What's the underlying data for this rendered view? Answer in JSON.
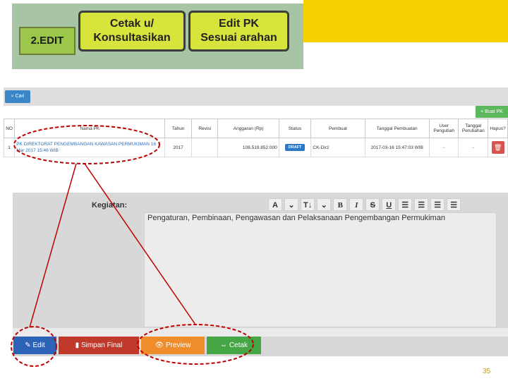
{
  "banner": {
    "edit_tab": "2.EDIT",
    "pill_cetak": [
      "Cetak u/",
      "Konsultasikan"
    ],
    "pill_edit": [
      "Edit PK",
      "Sesuai  arahan"
    ]
  },
  "toolbar": {
    "cari_label": "Cari",
    "buat_label": "+ Buat PK"
  },
  "table": {
    "headers": [
      "NO",
      "Nama PK",
      "Tahun",
      "Revisi",
      "Anggaran (Rp)",
      "Status",
      "Pembuat",
      "Tanggal Pembuatan",
      "User Pengubah",
      "Tanggal Perubahan",
      "Hapus?"
    ],
    "row": {
      "no": "1",
      "nama": "PK DIREKTORAT PENGEMBANGAN KAWASAN PERMUKIMAN 16 Mar 2017 15:46 WIB",
      "tahun": "2017",
      "revisi": "",
      "anggaran": "108.519.852.000",
      "status": "DRAFT",
      "pembuat": "CK-Dir2",
      "tanggal_pembuatan": "2017-03-16 15:47:03 WIB",
      "user_pengubah": "-",
      "tanggal_perubahan": "-"
    }
  },
  "editor": {
    "label": "Kegiatan:",
    "content": "Pengaturan, Pembinaan, Pengawasan dan Pelaksanaan Pengembangan Permukiman",
    "toolbar": [
      "A",
      "⌄",
      "T↓",
      "⌄",
      "B",
      "I",
      "S",
      "U",
      "☰",
      "☰",
      "☰",
      "☰"
    ]
  },
  "buttons": {
    "edit": "Edit",
    "simpan": "Simpan Final",
    "preview": "Preview",
    "cetak": "Cetak"
  },
  "page_number": "35",
  "colors": {
    "banner_yellow": "#f6d000",
    "pill": "#d6e43c",
    "annotation": "#c00000"
  }
}
